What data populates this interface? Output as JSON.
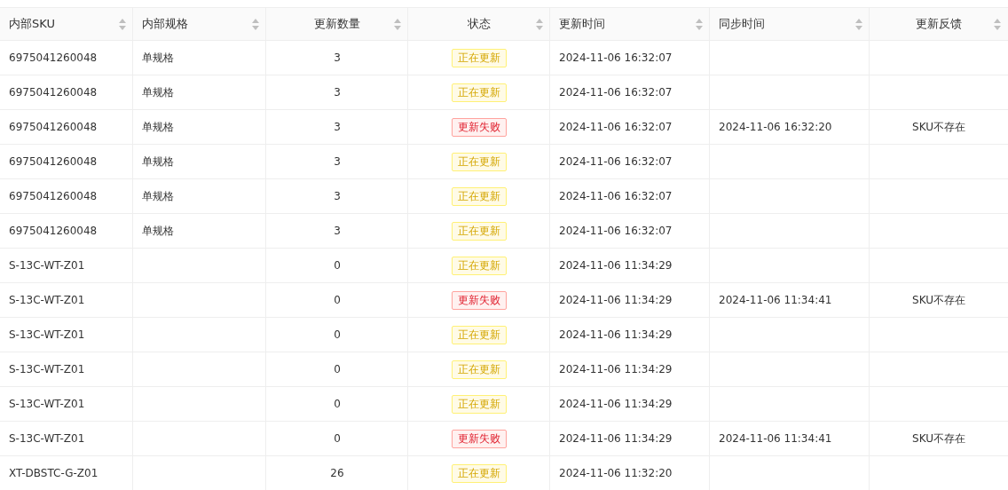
{
  "table": {
    "columns": [
      {
        "label": "内部SKU"
      },
      {
        "label": "内部规格"
      },
      {
        "label": "更新数量"
      },
      {
        "label": "状态"
      },
      {
        "label": "更新时间"
      },
      {
        "label": "同步时间"
      },
      {
        "label": "更新反馈"
      }
    ],
    "rows": [
      {
        "sku": "6975041260048",
        "spec": "单规格",
        "qty": "3",
        "status": {
          "kind": "updating",
          "label": "正在更新"
        },
        "update_time": "2024-11-06 16:32:07"
      },
      {
        "sku": "6975041260048",
        "spec": "单规格",
        "qty": "3",
        "status": {
          "kind": "updating",
          "label": "正在更新"
        },
        "update_time": "2024-11-06 16:32:07"
      },
      {
        "sku": "6975041260048",
        "spec": "单规格",
        "qty": "3",
        "status": {
          "kind": "failed",
          "label": "更新失败"
        },
        "update_time": "2024-11-06 16:32:07",
        "sync_time": "2024-11-06 16:32:20",
        "feedback": "SKU不存在"
      },
      {
        "sku": "6975041260048",
        "spec": "单规格",
        "qty": "3",
        "status": {
          "kind": "updating",
          "label": "正在更新"
        },
        "update_time": "2024-11-06 16:32:07"
      },
      {
        "sku": "6975041260048",
        "spec": "单规格",
        "qty": "3",
        "status": {
          "kind": "updating",
          "label": "正在更新"
        },
        "update_time": "2024-11-06 16:32:07"
      },
      {
        "sku": "6975041260048",
        "spec": "单规格",
        "qty": "3",
        "status": {
          "kind": "updating",
          "label": "正在更新"
        },
        "update_time": "2024-11-06 16:32:07"
      },
      {
        "sku": "S-13C-WT-Z01",
        "qty": "0",
        "status": {
          "kind": "updating",
          "label": "正在更新"
        },
        "update_time": "2024-11-06 11:34:29"
      },
      {
        "sku": "S-13C-WT-Z01",
        "qty": "0",
        "status": {
          "kind": "failed",
          "label": "更新失败"
        },
        "update_time": "2024-11-06 11:34:29",
        "sync_time": "2024-11-06 11:34:41",
        "feedback": "SKU不存在"
      },
      {
        "sku": "S-13C-WT-Z01",
        "qty": "0",
        "status": {
          "kind": "updating",
          "label": "正在更新"
        },
        "update_time": "2024-11-06 11:34:29"
      },
      {
        "sku": "S-13C-WT-Z01",
        "qty": "0",
        "status": {
          "kind": "updating",
          "label": "正在更新"
        },
        "update_time": "2024-11-06 11:34:29"
      },
      {
        "sku": "S-13C-WT-Z01",
        "qty": "0",
        "status": {
          "kind": "updating",
          "label": "正在更新"
        },
        "update_time": "2024-11-06 11:34:29"
      },
      {
        "sku": "S-13C-WT-Z01",
        "qty": "0",
        "status": {
          "kind": "failed",
          "label": "更新失败"
        },
        "update_time": "2024-11-06 11:34:29",
        "sync_time": "2024-11-06 11:34:41",
        "feedback": "SKU不存在"
      },
      {
        "sku": "XT-DBSTC-G-Z01",
        "qty": "26",
        "status": {
          "kind": "updating",
          "label": "正在更新"
        },
        "update_time": "2024-11-06 11:32:20"
      }
    ]
  }
}
